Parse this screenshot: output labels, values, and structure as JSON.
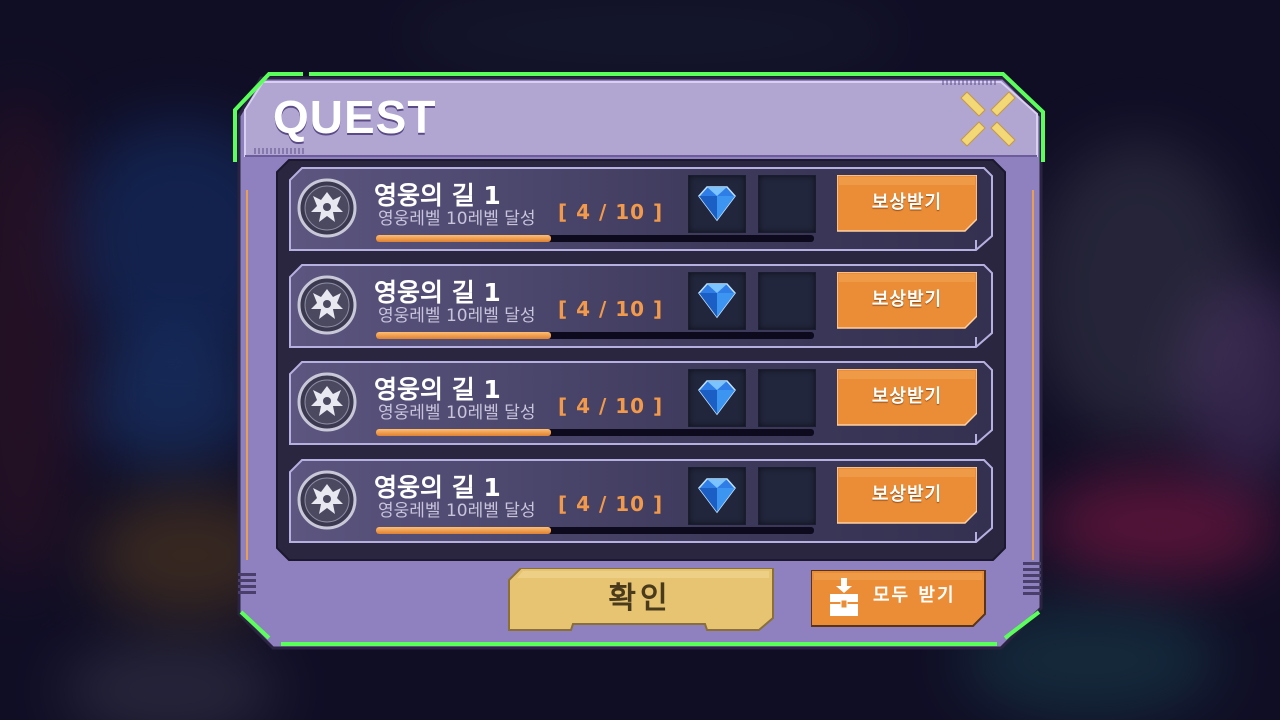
{
  "quest_window": {
    "title": "QUEST",
    "close_icon": "close-x-icon",
    "quests": [
      {
        "title": "영웅의 길 1",
        "description": "영웅레벨 10레벨 달성",
        "progress_text": "[ 4 / 10 ]",
        "progress_fraction": 0.4,
        "reward_icon": "blue-diamond-icon",
        "claim_label": "보상받기"
      },
      {
        "title": "영웅의 길 1",
        "description": "영웅레벨 10레벨 달성",
        "progress_text": "[ 4 / 10 ]",
        "progress_fraction": 0.4,
        "reward_icon": "blue-diamond-icon",
        "claim_label": "보상받기"
      },
      {
        "title": "영웅의 길 1",
        "description": "영웅레벨 10레벨 달성",
        "progress_text": "[ 4 / 10 ]",
        "progress_fraction": 0.4,
        "reward_icon": "blue-diamond-icon",
        "claim_label": "보상받기"
      },
      {
        "title": "영웅의 길 1",
        "description": "영웅레벨 10레벨 달성",
        "progress_text": "[ 4 / 10 ]",
        "progress_fraction": 0.4,
        "reward_icon": "blue-diamond-icon",
        "claim_label": "보상받기"
      }
    ],
    "confirm_label": "확인",
    "claim_all_label": "모두 받기",
    "claim_all_icon": "treasure-chest-icon"
  },
  "colors": {
    "panel": "#8f80c0",
    "header": "#b1a5d2",
    "accent_green": "#5bff5b",
    "orange": "#ea8d36",
    "gold": "#e6c472",
    "progress": "#f29a4a"
  }
}
